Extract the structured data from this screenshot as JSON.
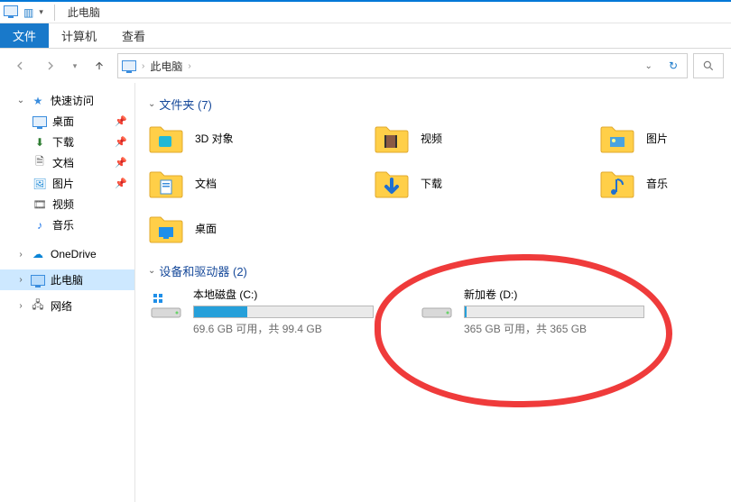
{
  "title": "此电脑",
  "ribbon": {
    "file": "文件",
    "computer": "计算机",
    "view": "查看"
  },
  "breadcrumb": {
    "root": "此电脑"
  },
  "sidebar": {
    "quick": "快速访问",
    "items": [
      "桌面",
      "下载",
      "文档",
      "图片",
      "视频",
      "音乐"
    ],
    "onedrive": "OneDrive",
    "thispc": "此电脑",
    "network": "网络"
  },
  "sections": {
    "folders_title": "文件夹 (7)",
    "drives_title": "设备和驱动器 (2)"
  },
  "folders": [
    {
      "label": "3D 对象"
    },
    {
      "label": "视频"
    },
    {
      "label": "图片"
    },
    {
      "label": "文档"
    },
    {
      "label": "下载"
    },
    {
      "label": "音乐"
    },
    {
      "label": "桌面"
    }
  ],
  "drives": [
    {
      "name": "本地磁盘 (C:)",
      "status": "69.6 GB 可用，共 99.4 GB",
      "fill_pct": 30
    },
    {
      "name": "新加卷 (D:)",
      "status": "365 GB 可用，共 365 GB",
      "fill_pct": 1
    }
  ]
}
